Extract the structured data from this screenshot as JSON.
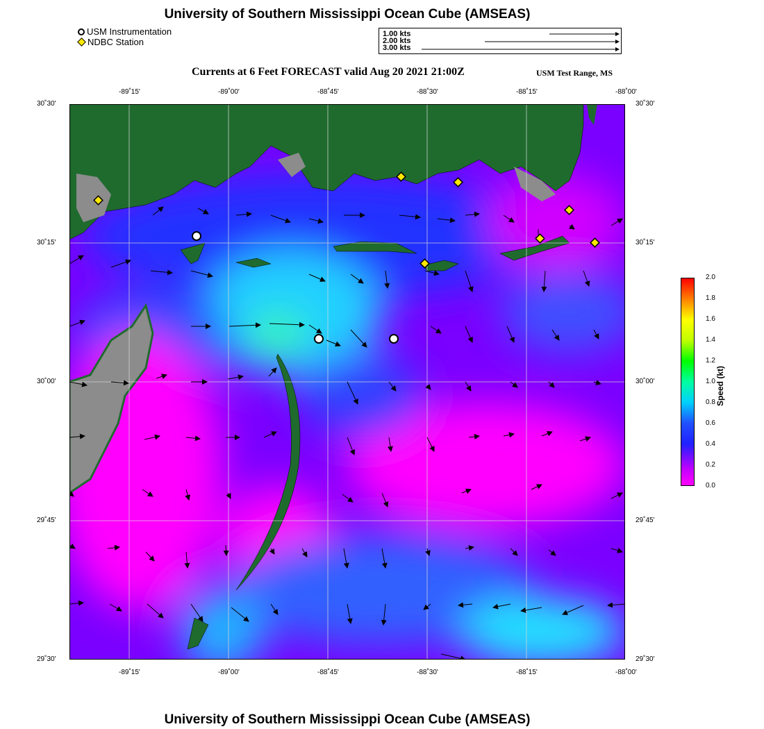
{
  "title": "University of Southern Mississippi Ocean Cube (AMSEAS)",
  "footer_title": "University of Southern Mississippi Ocean Cube (AMSEAS)",
  "legend": {
    "instrumentation_label": "USM Instrumentation",
    "ndbc_label": "NDBC Station"
  },
  "vector_key": [
    "1.00 kts",
    "2.00 kts",
    "3.00 kts"
  ],
  "subtitle": "Currents at 6 Feet FORECAST valid Aug 20 2021 21:00Z",
  "range_label": "USM Test Range, MS",
  "axes": {
    "lon_ticks": [
      "-89˚15'",
      "-89˚00'",
      "-88˚45'",
      "-88˚30'",
      "-88˚15'",
      "-88˚00'"
    ],
    "lat_ticks": [
      "30˚30'",
      "30˚15'",
      "30˚00'",
      "29˚45'",
      "29˚30'"
    ]
  },
  "colorbar": {
    "label": "Speed (kt)",
    "ticks": [
      "2.0",
      "1.8",
      "1.6",
      "1.4",
      "1.2",
      "1.0",
      "0.8",
      "0.6",
      "0.4",
      "0.2",
      "0.0"
    ],
    "colors": [
      "#ff00ff",
      "#2020ff",
      "#00d0ff",
      "#00ff00",
      "#ffff00",
      "#ff0000"
    ]
  },
  "colors": {
    "land": "#1f6b2e",
    "marsh": "#8c8c8c",
    "diamond": "#ffe800"
  }
}
